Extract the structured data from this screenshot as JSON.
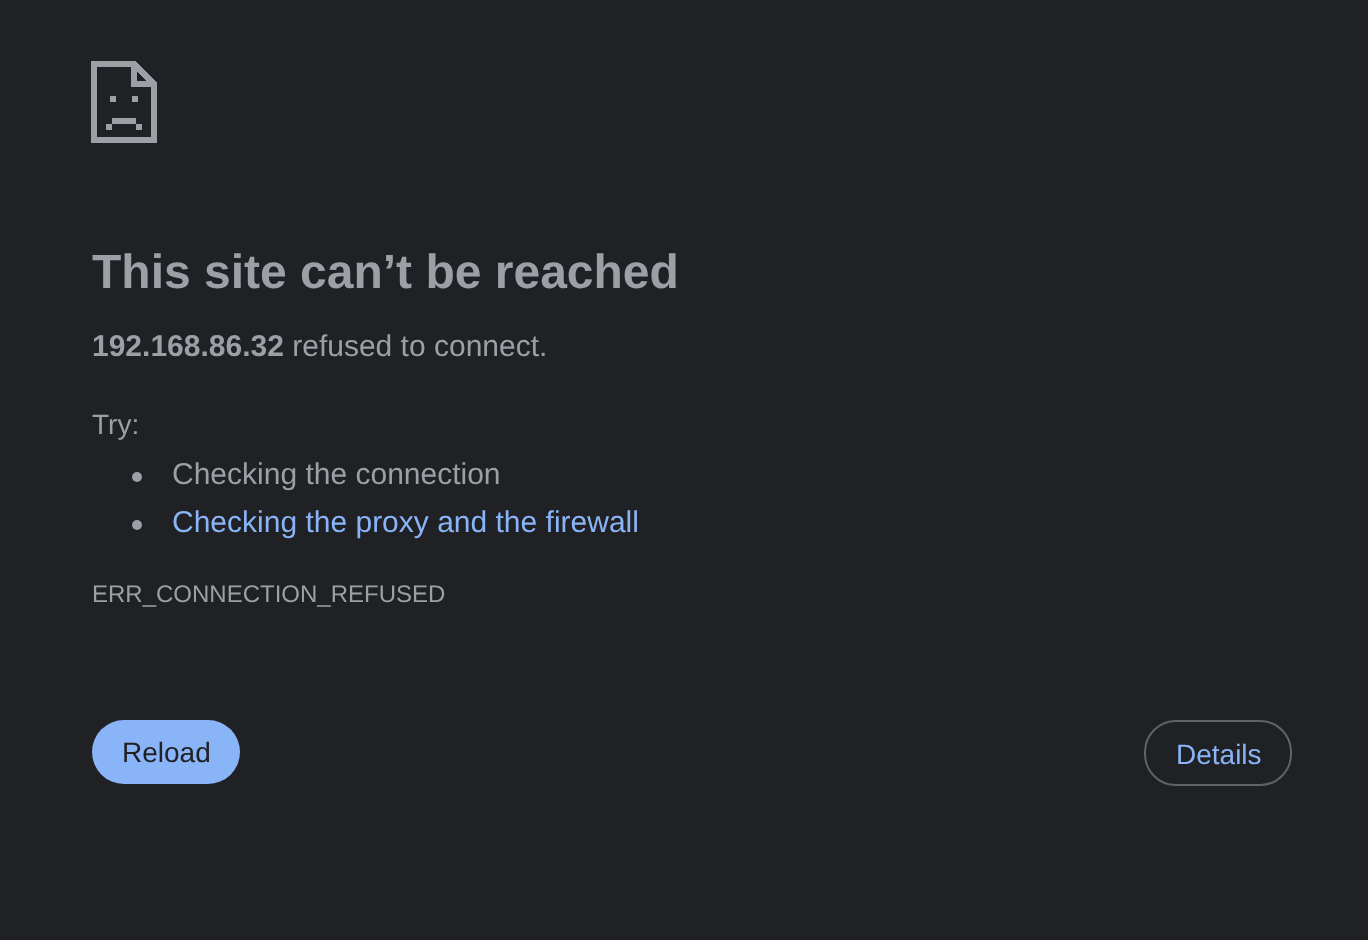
{
  "heading": "This site can’t be reached",
  "summary": "**192.168.86.32** refused to connect.",
  "suggestions_label": "Try:",
  "suggestions": [
    {
      "text": "Checking the connection",
      "kind": "text"
    },
    {
      "text": "Checking the proxy and the firewall",
      "kind": "link"
    }
  ],
  "error_code": "ERR_CONNECTION_REFUSED",
  "buttons": [
    {
      "label": "Reload",
      "kind": "primary"
    },
    {
      "label": "Details",
      "kind": "secondary"
    }
  ]
}
